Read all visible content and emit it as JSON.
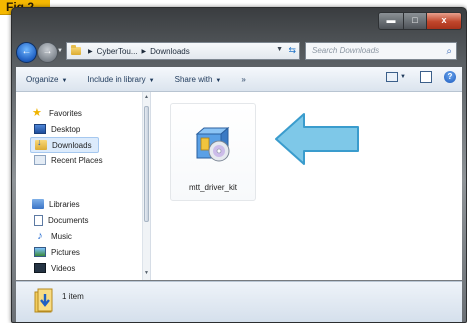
{
  "figure_label": "Fig.2",
  "titlebar": {
    "min_glyph": "▬",
    "max_glyph": "□",
    "close_glyph": "x"
  },
  "address_bar": {
    "breadcrumb": [
      "CyberTou...",
      "Downloads"
    ],
    "search_placeholder": "Search Downloads"
  },
  "toolbar": {
    "organize": "Organize",
    "include_in_library": "Include in library",
    "share_with": "Share with",
    "more": "»"
  },
  "nav_pane": {
    "favorites_label": "Favorites",
    "favorites": [
      "Desktop",
      "Downloads",
      "Recent Places"
    ],
    "libraries_label": "Libraries",
    "libraries": [
      "Documents",
      "Music",
      "Pictures",
      "Videos"
    ],
    "selected": "Downloads"
  },
  "content": {
    "files": [
      {
        "name": "mtt_driver_kit",
        "icon": "installer-package-icon"
      }
    ],
    "annotation_arrow_color": "#7ec8e8"
  },
  "status_bar": {
    "item_count": "1 item"
  },
  "colors": {
    "figure_label_bg": "#f5b800",
    "selection_bg": "#dcebfc",
    "arrow_fill": "#7ec8e8",
    "arrow_stroke": "#3a9ccd"
  }
}
